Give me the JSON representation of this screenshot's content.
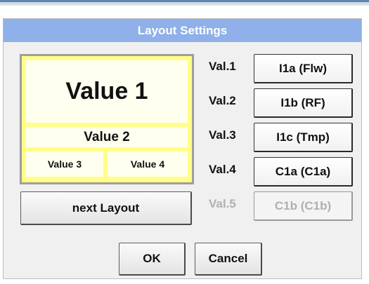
{
  "dialog": {
    "title": "Layout Settings"
  },
  "preview": {
    "value1": "Value 1",
    "value2": "Value 2",
    "value3": "Value 3",
    "value4": "Value 4",
    "highlight_color": "#ffff88"
  },
  "buttons": {
    "next_layout": "next Layout",
    "ok": "OK",
    "cancel": "Cancel"
  },
  "values": [
    {
      "label": "Val.1",
      "channel": "I1a (Flw)",
      "enabled": true
    },
    {
      "label": "Val.2",
      "channel": "I1b (RF)",
      "enabled": true
    },
    {
      "label": "Val.3",
      "channel": "I1c (Tmp)",
      "enabled": true
    },
    {
      "label": "Val.4",
      "channel": "C1a (C1a)",
      "enabled": true
    },
    {
      "label": "Val.5",
      "channel": "C1b (C1b)",
      "enabled": false
    }
  ],
  "colors": {
    "title_bar": "#8fb0e8",
    "disabled_text": "#b0b0b0"
  }
}
